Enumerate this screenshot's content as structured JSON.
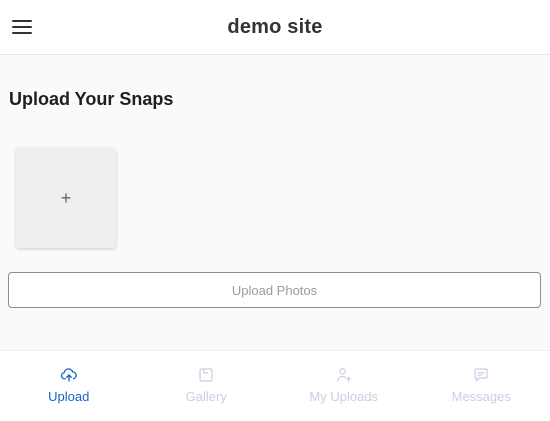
{
  "header": {
    "title": "demo site",
    "menu_icon": "hamburger-menu-icon"
  },
  "main": {
    "section_title": "Upload Your Snaps",
    "add_tile_symbol": "+",
    "upload_button_label": "Upload Photos"
  },
  "bottom_nav": {
    "items": [
      {
        "label": "Upload",
        "icon": "cloud-upload-icon",
        "active": true
      },
      {
        "label": "Gallery",
        "icon": "gallery-icon",
        "active": false
      },
      {
        "label": "My Uploads",
        "icon": "user-upload-icon",
        "active": false
      },
      {
        "label": "Messages",
        "icon": "message-icon",
        "active": false
      }
    ]
  },
  "colors": {
    "active": "#1565c0",
    "inactive": "#c9cfe0",
    "header_bg": "#ffffff",
    "page_bg": "#fafafa"
  }
}
